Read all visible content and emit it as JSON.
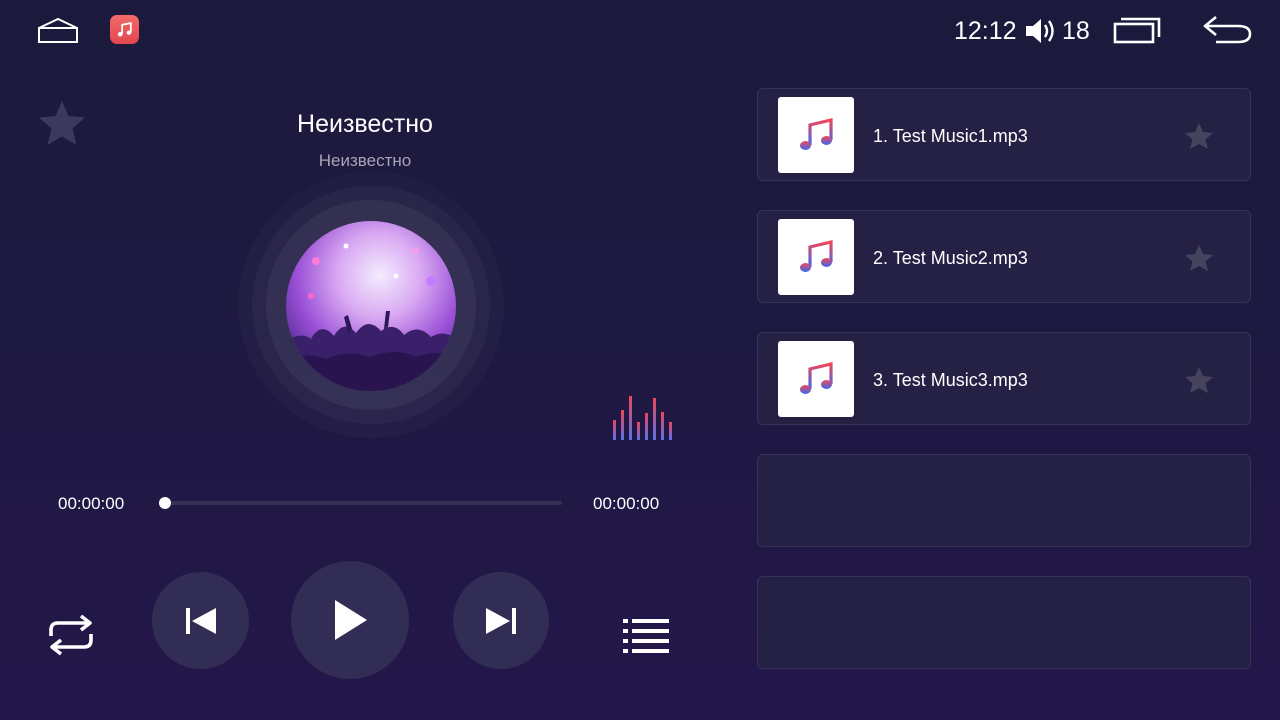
{
  "status_bar": {
    "time": "12:12",
    "volume": "18",
    "icons": [
      "home-icon",
      "music-app-icon",
      "volume-icon",
      "recent-apps-icon",
      "back-icon"
    ]
  },
  "player": {
    "title": "Неизвестно",
    "artist": "Неизвестно",
    "current_time": "00:00:00",
    "total_time": "00:00:00",
    "progress": 0,
    "controls": [
      "repeat-icon",
      "previous-icon",
      "play-icon",
      "next-icon",
      "playlist-icon"
    ]
  },
  "playlist": {
    "tracks": [
      {
        "name": "1. Test Music1.mp3"
      },
      {
        "name": "2. Test Music2.mp3"
      },
      {
        "name": "3. Test Music3.mp3"
      },
      {
        "name": ""
      },
      {
        "name": ""
      }
    ]
  },
  "colors": {
    "background": "#1e1941",
    "card": "#242145",
    "button": "#322d55",
    "accent_red": "#e2474f",
    "accent_blue": "#3a6bf0"
  }
}
